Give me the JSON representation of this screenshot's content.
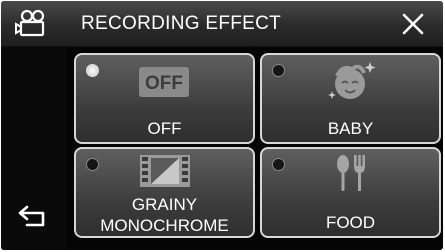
{
  "header": {
    "title": "RECORDING EFFECT",
    "mode_icon": "video-camera-icon",
    "close_icon": "close-icon"
  },
  "nav": {
    "back_icon": "back-arrow-icon"
  },
  "effects": [
    {
      "label": "OFF",
      "icon": "off-icon",
      "selected": true
    },
    {
      "label": "BABY",
      "icon": "baby-face-icon",
      "selected": false
    },
    {
      "label_line1": "GRAINY",
      "label_line2": "MONOCHROME",
      "icon": "film-strip-icon",
      "selected": false
    },
    {
      "label": "FOOD",
      "icon": "spoon-fork-icon",
      "selected": false
    }
  ],
  "colors": {
    "background": "#050505",
    "tile_border": "#d7d7d7",
    "text": "#ffffff"
  }
}
